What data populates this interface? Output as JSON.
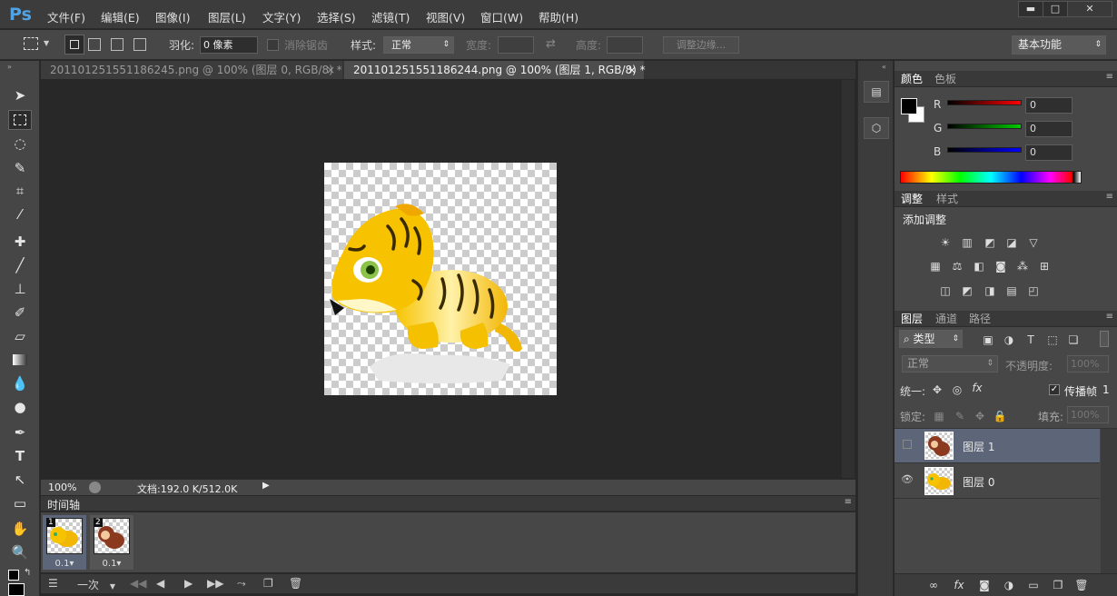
{
  "app": {
    "logo": "Ps"
  },
  "menu": [
    "文件(F)",
    "编辑(E)",
    "图像(I)",
    "图层(L)",
    "文字(Y)",
    "选择(S)",
    "滤镜(T)",
    "视图(V)",
    "窗口(W)",
    "帮助(H)"
  ],
  "window_controls": {
    "minimize": "▬",
    "maximize": "□",
    "close": "✕"
  },
  "options": {
    "feather_label": "羽化:",
    "feather_value": "0 像素",
    "antialias_label": "消除锯齿",
    "style_label": "样式:",
    "style_value": "正常",
    "width_label": "宽度:",
    "height_label": "高度:",
    "refine_edge": "调整边缘...",
    "workspace": "基本功能"
  },
  "tabs": [
    {
      "label": "201101251551186245.png @ 100% (图层 0, RGB/8) *",
      "close": "×"
    },
    {
      "label": "201101251551186244.png @ 100% (图层 1, RGB/8) *",
      "close": "×"
    }
  ],
  "status": {
    "zoom": "100%",
    "doc": "文档:192.0 K/512.0K"
  },
  "timeline": {
    "title": "时间轴",
    "frames": [
      {
        "number": "1",
        "delay": "0.1▾"
      },
      {
        "number": "2",
        "delay": "0.1▾"
      }
    ],
    "loop": "一次"
  },
  "color_panel": {
    "tabs": [
      "颜色",
      "色板"
    ],
    "channels": [
      {
        "label": "R",
        "value": "0"
      },
      {
        "label": "G",
        "value": "0"
      },
      {
        "label": "B",
        "value": "0"
      }
    ]
  },
  "adjust_panel": {
    "tabs": [
      "调整",
      "样式"
    ],
    "title": "添加调整"
  },
  "layers_panel": {
    "tabs": [
      "图层",
      "通道",
      "路径"
    ],
    "filter_kind": "类型",
    "blend_mode": "正常",
    "opacity_label": "不透明度:",
    "opacity_value": "100%",
    "unify_label": "统一:",
    "propagate_label": "传播帧",
    "propagate_value": "1",
    "lock_label": "锁定:",
    "fill_label": "填充:",
    "fill_value": "100%",
    "layers": [
      {
        "name": "图层 1",
        "visible": false,
        "selected": true
      },
      {
        "name": "图层 0",
        "visible": true,
        "selected": false
      }
    ]
  },
  "colors": {
    "accent": "#4fa4e8",
    "selected_layer": "#5c6678",
    "tiger_orange": "#f2b705",
    "monkey_brown": "#8b3a1f"
  }
}
